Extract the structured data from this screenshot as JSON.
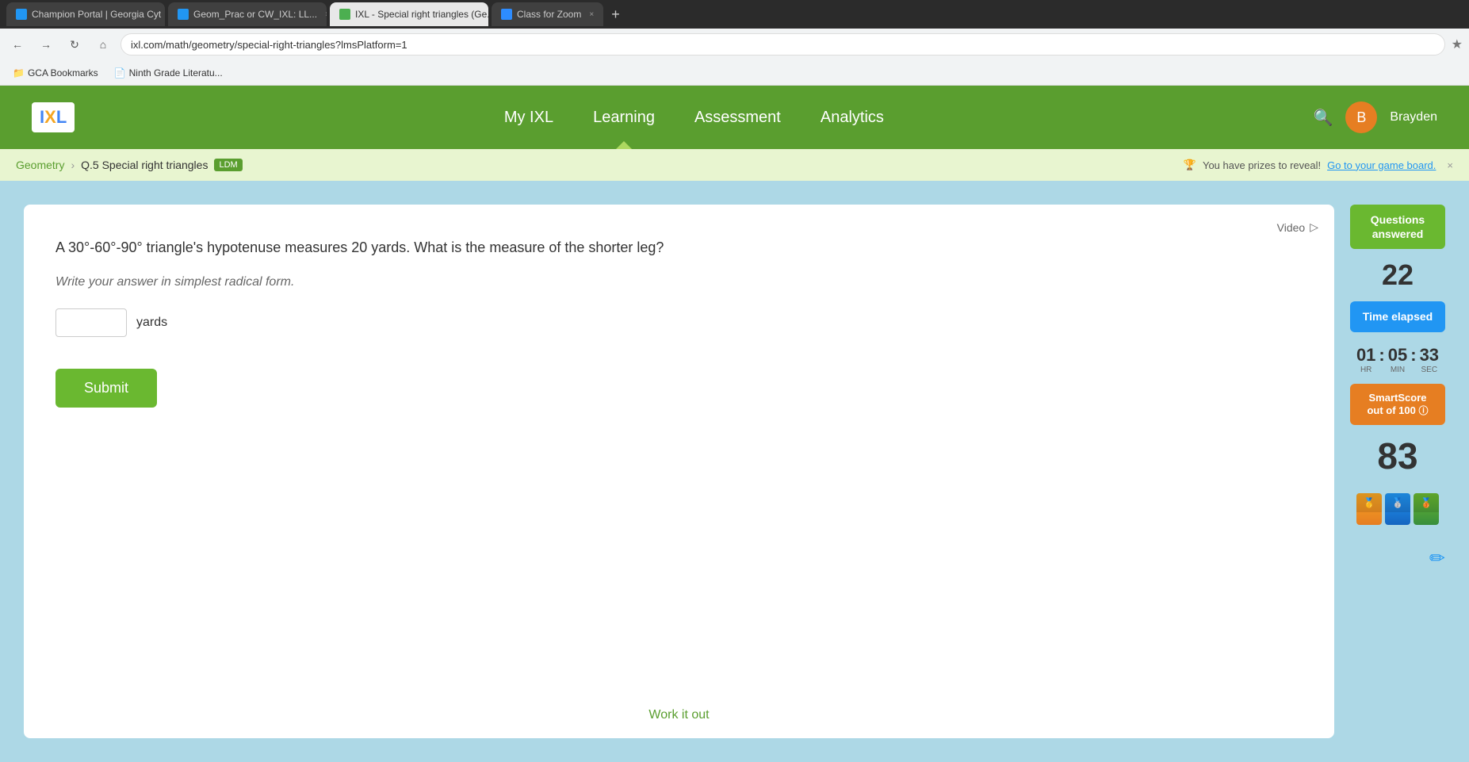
{
  "browser": {
    "tabs": [
      {
        "id": "tab1",
        "title": "Champion Portal | Georgia Cyt",
        "active": false,
        "favicon_type": "blue"
      },
      {
        "id": "tab2",
        "title": "Geom_Prac or CW_IXL: LL...",
        "active": false,
        "favicon_type": "blue"
      },
      {
        "id": "tab3",
        "title": "IXL - Special right triangles (Ge...",
        "active": true,
        "favicon_type": "ixl"
      },
      {
        "id": "tab4",
        "title": "Class for Zoom",
        "active": false,
        "favicon_type": "zoom"
      }
    ],
    "address": "ixl.com/math/geometry/special-right-triangles?lmsPlatform=1",
    "bookmarks": [
      {
        "label": "GCA Bookmarks",
        "icon": "folder"
      },
      {
        "label": "Ninth Grade Literatu...",
        "icon": "page"
      }
    ]
  },
  "nav": {
    "logo_text": "IXL",
    "items": [
      {
        "id": "my-ixl",
        "label": "My IXL"
      },
      {
        "id": "learning",
        "label": "Learning",
        "active": true
      },
      {
        "id": "assessment",
        "label": "Assessment"
      },
      {
        "id": "analytics",
        "label": "Analytics"
      }
    ],
    "user_name": "Brayden"
  },
  "breadcrumb": {
    "parent": "Geometry",
    "current": "Q.5 Special right triangles",
    "badge": "LDM"
  },
  "prize_banner": {
    "text": "You have prizes to reveal!",
    "link_text": "Go to your game board.",
    "close_label": "×"
  },
  "question": {
    "text": "A 30°-60°-90° triangle's hypotenuse measures 20 yards. What is the measure of the shorter leg?",
    "hint": "Write your answer in simplest radical form.",
    "answer_placeholder": "",
    "unit": "yards",
    "submit_label": "Submit",
    "video_label": "Video",
    "work_it_out_label": "Work it out"
  },
  "sidebar": {
    "questions_answered_label": "Questions answered",
    "questions_count": "22",
    "time_elapsed_label": "Time elapsed",
    "timer": {
      "hr": "01",
      "min": "05",
      "sec": "33",
      "hr_label": "HR",
      "min_label": "MIN",
      "sec_label": "SEC"
    },
    "smart_score_label": "SmartScore",
    "smart_score_suffix": "out of 100",
    "smart_score_value": "83",
    "badges": [
      {
        "type": "gold",
        "label": "gold badge"
      },
      {
        "type": "blue",
        "label": "blue badge"
      },
      {
        "type": "green",
        "label": "green badge"
      }
    ],
    "pencil_icon": "✏"
  }
}
